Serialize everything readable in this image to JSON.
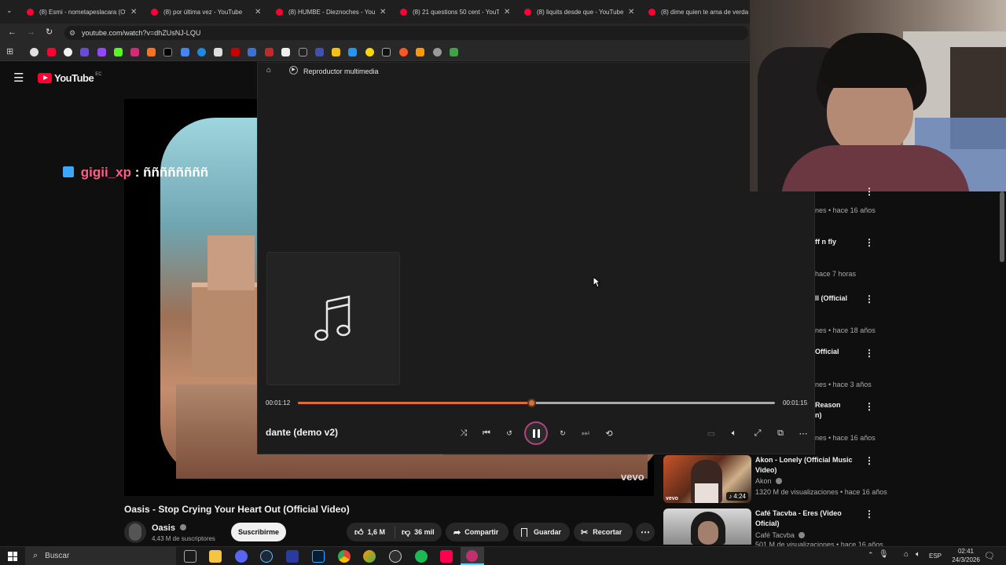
{
  "browser": {
    "tabs": [
      {
        "title": "(8) Esmi - nometapeslacara (Of"
      },
      {
        "title": "(8) por última vez - YouTube"
      },
      {
        "title": "(8) HUMBE - Dieznoches - YouT"
      },
      {
        "title": "(8) 21 questions 50 cent - YouT"
      },
      {
        "title": "(8) liquits desde que - YouTube"
      },
      {
        "title": "(8) dime quien te ama de verda"
      }
    ],
    "url": "youtube.com/watch?v=dhZUsNJ-LQU"
  },
  "youtube": {
    "logo": "YouTube",
    "region": "EC",
    "overlay": {
      "username": "gigii_xp",
      "message": ": ññññññññ"
    },
    "vevo": "vevo",
    "video_title": "Oasis - Stop Crying Your Heart Out (Official Video)",
    "channel": "Oasis",
    "subscribers": "4,43 M de suscriptores",
    "subscribe_label": "Suscribirme",
    "likes": "1,6 M",
    "dislikes": "36 mil",
    "share_label": "Compartir",
    "save_label": "Guardar",
    "clip_label": "Recortar"
  },
  "player": {
    "app_title": "Reproductor multimedia",
    "track": "dante (demo v2)",
    "elapsed": "00:01:12",
    "duration": "00:01:15",
    "progress": 0.49
  },
  "sidebar": {
    "items": [
      {
        "title": "",
        "meta": "nes • hace 16 años"
      },
      {
        "title": "ff n fly",
        "meta": "hace 7 horas"
      },
      {
        "title": "ll (Official",
        "meta": "nes • hace 18 años"
      },
      {
        "title": "Official",
        "meta": "nes • hace 3 años"
      },
      {
        "title": "Reason",
        "title2": "n)",
        "meta": "nes • hace 16 años"
      },
      {
        "title": "Akon - Lonely (Official Music",
        "title2": "Video)",
        "channel": "Akon",
        "meta": "1320 M de visualizaciones • hace 16 años",
        "duration": "4:24",
        "badge": "vevo"
      },
      {
        "title": "Café Tacvba - Eres (Video",
        "title2": "Oficial)",
        "channel": "Café Tacvba",
        "meta": "501 M de visualizaciones • hace 16 años"
      }
    ]
  },
  "taskbar": {
    "search_placeholder": "Buscar",
    "lang": "ESP",
    "time": "02:41",
    "date": "24/3/2026"
  },
  "colors": {
    "accent": "#e06d32",
    "youtube_red": "#ff0033",
    "overlay_name": "#ff5c8a",
    "background": "#0f0f0f"
  }
}
